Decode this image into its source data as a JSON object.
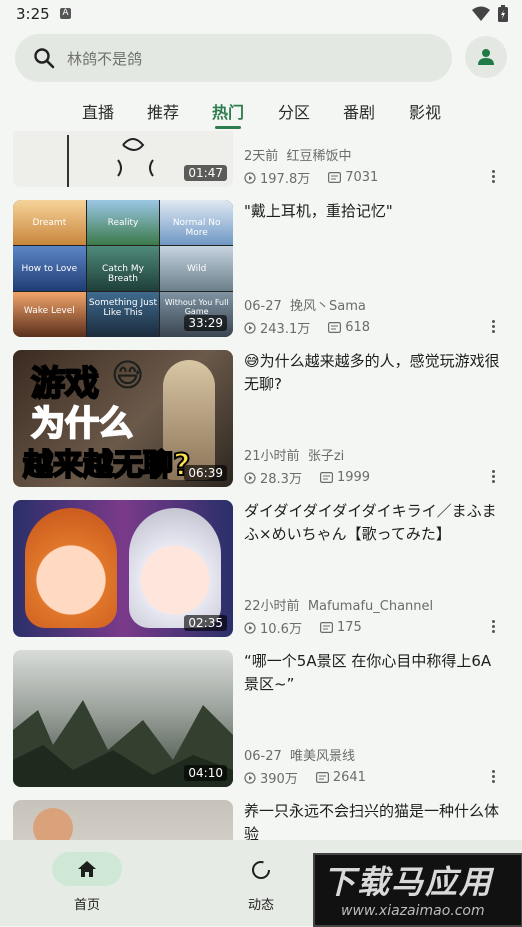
{
  "status_bar": {
    "time": "3:25",
    "notification_letter": "A"
  },
  "search": {
    "placeholder": "林鸽不是鸽"
  },
  "tabs": [
    {
      "label": "直播"
    },
    {
      "label": "推荐"
    },
    {
      "label": "热门",
      "active": true
    },
    {
      "label": "分区"
    },
    {
      "label": "番剧"
    },
    {
      "label": "影视"
    }
  ],
  "videos": [
    {
      "title": "",
      "duration": "01:47",
      "meta_left": "2天前",
      "author": "红豆稀饭中",
      "views": "197.8万",
      "danmaku": "7031"
    },
    {
      "title": "\"戴上耳机，重拾记忆\"",
      "duration": "33:29",
      "meta_left": "06-27",
      "author": "挽风丶Sama",
      "views": "243.1万",
      "danmaku": "618",
      "thumb_labels": [
        "Dreamt",
        "Reality",
        "Normal No More",
        "How to Love",
        "Catch My Breath",
        "Wild",
        "Wake Level",
        "Something Just Like This",
        "Without You Full Game"
      ]
    },
    {
      "title": "😅为什么越来越多的人，感觉玩游戏很无聊?",
      "duration": "06:39",
      "meta_left": "21小时前",
      "author": "张子zi",
      "views": "28.3万",
      "danmaku": "1999",
      "thumb_text": {
        "line1": "游戏",
        "line2": "为什么",
        "line3": "越来越无聊?"
      }
    },
    {
      "title": "ダイダイダイダイダイキライ／まふまふ×めいちゃん【歌ってみた】",
      "duration": "02:35",
      "meta_left": "22小时前",
      "author": "Mafumafu_Channel",
      "views": "10.6万",
      "danmaku": "175"
    },
    {
      "title": "“哪一个5A景区 在你心目中称得上6A景区~”",
      "duration": "04:10",
      "meta_left": "06-27",
      "author": "唯美风景线",
      "views": "390万",
      "danmaku": "2641"
    },
    {
      "title": "养一只永远不会扫兴的猫是一种什么体验",
      "duration": "",
      "meta_left": "",
      "author": "",
      "views": "",
      "danmaku": ""
    }
  ],
  "bottom_nav": [
    {
      "label": "首页",
      "icon": "home-icon",
      "active": true
    },
    {
      "label": "动态",
      "icon": "refresh-circle-icon",
      "active": false
    }
  ],
  "watermark": {
    "line1": "下载马应用",
    "line2": "www.xiazaimao.com"
  },
  "colors": {
    "accent": "#2e7d4f",
    "background": "#f3f6f2",
    "nav_active": "#cfe8d6"
  }
}
